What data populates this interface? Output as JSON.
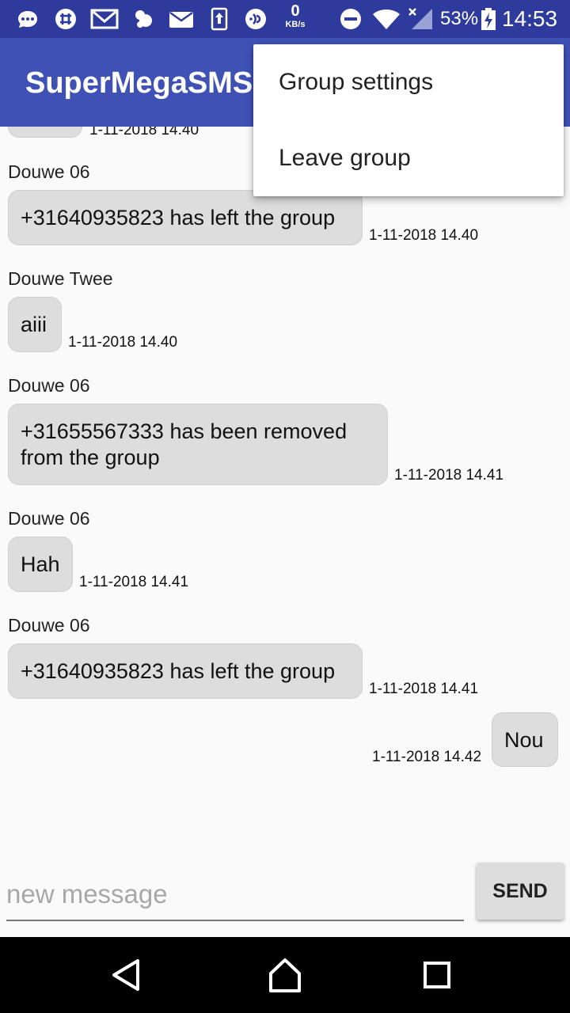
{
  "status_bar": {
    "network_speed_value": "0",
    "network_speed_unit": "KB/s",
    "battery_percent": "53%",
    "time": "14:53",
    "icons": [
      "messenger-icon",
      "slack-icon",
      "gmail-icon",
      "hangouts-icon",
      "email-icon",
      "data-transfer-icon",
      "nfc-icon",
      "dnd-icon",
      "wifi-icon",
      "signal-icon",
      "battery-icon"
    ]
  },
  "app_bar": {
    "title": "SuperMegaSMS"
  },
  "overflow_menu": {
    "items": [
      {
        "label": "Group settings"
      },
      {
        "label": "Leave group"
      }
    ]
  },
  "messages": [
    {
      "sender": "",
      "text": "",
      "time": "1-11-2018 14.40",
      "outgoing": false
    },
    {
      "sender": "Douwe 06",
      "text": "+31640935823 has left the group",
      "time": "1-11-2018 14.40",
      "outgoing": false
    },
    {
      "sender": "Douwe Twee",
      "text": "aiii",
      "time": "1-11-2018 14.40",
      "outgoing": false
    },
    {
      "sender": "Douwe 06",
      "text": "+31655567333 has been removed from the group",
      "time": "1-11-2018 14.41",
      "outgoing": false
    },
    {
      "sender": "Douwe 06",
      "text": "Hah",
      "time": "1-11-2018 14.41",
      "outgoing": false
    },
    {
      "sender": "Douwe 06",
      "text": "+31640935823 has left the group",
      "time": "1-11-2018 14.41",
      "outgoing": false
    },
    {
      "sender": "",
      "text": "Nou",
      "time": "1-11-2018 14.42",
      "outgoing": true
    }
  ],
  "composer": {
    "placeholder": "new message",
    "value": "",
    "send_label": "SEND"
  },
  "colors": {
    "primary": "#3f51b5",
    "primary_dark": "#2e3b9c",
    "bubble": "#dddddd",
    "background": "#fafafa"
  }
}
